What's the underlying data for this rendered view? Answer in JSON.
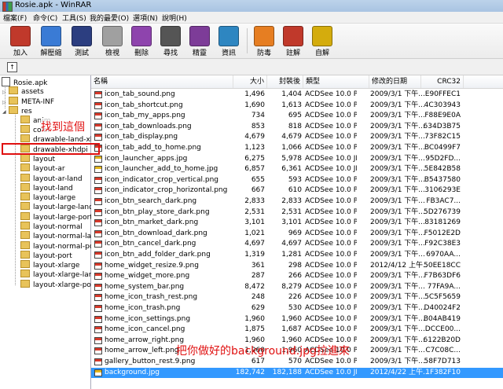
{
  "window": {
    "title": "Rosie.apk - WinRAR"
  },
  "menu": [
    "檔案(F)",
    "命令(C)",
    "工具(S)",
    "我的最愛(O)",
    "選項(N)",
    "說明(H)"
  ],
  "toolbar": [
    "加入",
    "解壓縮到",
    "測試",
    "檢視",
    "刪除",
    "尋找",
    "精靈",
    "資訊",
    "防毒",
    "註解",
    "自解"
  ],
  "toolbar_colors": {
    "add": "#c0392b",
    "extract": "#3a7bd5",
    "test": "#2c3e80",
    "view": "#a0a0a0",
    "delete": "#8e44ad",
    "find": "#555555",
    "wizard": "#7d3c98",
    "info": "#2e86c1",
    "virus": "#e67e22",
    "comment": "#c0392b",
    "sfx": "#d4ac0d"
  },
  "tree": {
    "root": "Rosie.apk",
    "top_items": [
      "assets",
      "META-INF",
      "res"
    ],
    "res_items": [
      "anim",
      "color",
      "drawable-land-xhdpi",
      "drawable-xhdpi",
      "layout",
      "layout-ar",
      "layout-ar-land",
      "layout-land",
      "layout-large",
      "layout-large-land",
      "layout-large-port",
      "layout-normal",
      "layout-normal-land",
      "layout-normal-port",
      "layout-port",
      "layout-xlarge",
      "layout-xlarge-land",
      "layout-xlarge-port"
    ]
  },
  "columns": {
    "name": "名稱",
    "size": "大小",
    "packed": "封裝後",
    "type": "類型",
    "modified": "修改的日期",
    "crc": "CRC32"
  },
  "files": [
    {
      "name": "icon_tab_sound.png",
      "size": "1,496",
      "packed": "1,404",
      "type": "ACDSee 10.0 PN...",
      "modified": "2009/3/1 下午...",
      "crc": "E90FFEC1",
      "kind": "png"
    },
    {
      "name": "icon_tab_shortcut.png",
      "size": "1,690",
      "packed": "1,613",
      "type": "ACDSee 10.0 PN...",
      "modified": "2009/3/1 下午...",
      "crc": "4C303943",
      "kind": "png"
    },
    {
      "name": "icon_tab_my_apps.png",
      "size": "734",
      "packed": "695",
      "type": "ACDSee 10.0 PN...",
      "modified": "2009/3/1 下午...",
      "crc": "F88E9E0A",
      "kind": "png"
    },
    {
      "name": "icon_tab_downloads.png",
      "size": "853",
      "packed": "818",
      "type": "ACDSee 10.0 PN...",
      "modified": "2009/3/1 下午...",
      "crc": "634D3B75",
      "kind": "png"
    },
    {
      "name": "icon_tab_display.png",
      "size": "4,679",
      "packed": "4,679",
      "type": "ACDSee 10.0 PN...",
      "modified": "2009/3/1 下午...",
      "crc": "73F82C15",
      "kind": "png"
    },
    {
      "name": "icon_tab_add_to_home.png",
      "size": "1,123",
      "packed": "1,066",
      "type": "ACDSee 10.0 PN...",
      "modified": "2009/3/1 下午...",
      "crc": "BC0499F7",
      "kind": "png"
    },
    {
      "name": "icon_launcher_apps.jpg",
      "size": "6,275",
      "packed": "5,978",
      "type": "ACDSee 10.0 JPE...",
      "modified": "2009/3/1 下午...",
      "crc": "95D2FD...",
      "kind": "jpg"
    },
    {
      "name": "icon_launcher_add_to_home.jpg",
      "size": "6,857",
      "packed": "6,361",
      "type": "ACDSee 10.0 JPE...",
      "modified": "2009/3/1 下午...",
      "crc": "5E842B58",
      "kind": "jpg"
    },
    {
      "name": "icon_indicator_crop_vertical.png",
      "size": "655",
      "packed": "593",
      "type": "ACDSee 10.0 PN...",
      "modified": "2009/3/1 下午...",
      "crc": "B5437580",
      "kind": "png"
    },
    {
      "name": "icon_indicator_crop_horizontal.png",
      "size": "667",
      "packed": "610",
      "type": "ACDSee 10.0 PN...",
      "modified": "2009/3/1 下午...",
      "crc": "3106293E",
      "kind": "png"
    },
    {
      "name": "icon_btn_search_dark.png",
      "size": "2,833",
      "packed": "2,833",
      "type": "ACDSee 10.0 PN...",
      "modified": "2009/3/1 下午...",
      "crc": "FB3AC7...",
      "kind": "png"
    },
    {
      "name": "icon_btn_play_store_dark.png",
      "size": "2,531",
      "packed": "2,531",
      "type": "ACDSee 10.0 PN...",
      "modified": "2009/3/1 下午...",
      "crc": "5D276739",
      "kind": "png"
    },
    {
      "name": "icon_btn_market_dark.png",
      "size": "3,101",
      "packed": "3,101",
      "type": "ACDSee 10.0 PN...",
      "modified": "2009/3/1 下午...",
      "crc": "83181269",
      "kind": "png"
    },
    {
      "name": "icon_btn_download_dark.png",
      "size": "1,021",
      "packed": "969",
      "type": "ACDSee 10.0 PN...",
      "modified": "2009/3/1 下午...",
      "crc": "F5012E2D",
      "kind": "png"
    },
    {
      "name": "icon_btn_cancel_dark.png",
      "size": "4,697",
      "packed": "4,697",
      "type": "ACDSee 10.0 PN...",
      "modified": "2009/3/1 下午...",
      "crc": "F92C38E3",
      "kind": "png"
    },
    {
      "name": "icon_btn_add_folder_dark.png",
      "size": "1,319",
      "packed": "1,281",
      "type": "ACDSee 10.0 PN...",
      "modified": "2009/3/1 下午...",
      "crc": "6970AA...",
      "kind": "png"
    },
    {
      "name": "home_widget_resize.9.png",
      "size": "361",
      "packed": "298",
      "type": "ACDSee 10.0 PN...",
      "modified": "2012/4/12 上午...",
      "crc": "50EE18CC",
      "kind": "png"
    },
    {
      "name": "home_widget_more.png",
      "size": "287",
      "packed": "266",
      "type": "ACDSee 10.0 PN...",
      "modified": "2009/3/1 下午...",
      "crc": "F7B63DF6",
      "kind": "png"
    },
    {
      "name": "home_system_bar.png",
      "size": "8,472",
      "packed": "8,279",
      "type": "ACDSee 10.0 PN...",
      "modified": "2009/3/1 下午...",
      "crc": "77FA9A...",
      "kind": "png"
    },
    {
      "name": "home_icon_trash_rest.png",
      "size": "248",
      "packed": "226",
      "type": "ACDSee 10.0 PN...",
      "modified": "2009/3/1 下午...",
      "crc": "5C5F5659",
      "kind": "png"
    },
    {
      "name": "home_icon_trash.png",
      "size": "629",
      "packed": "530",
      "type": "ACDSee 10.0 PN...",
      "modified": "2009/3/1 下午...",
      "crc": "D40024F2",
      "kind": "png"
    },
    {
      "name": "home_icon_settings.png",
      "size": "1,960",
      "packed": "1,960",
      "type": "ACDSee 10.0 PN...",
      "modified": "2009/3/1 下午...",
      "crc": "B04AB419",
      "kind": "png"
    },
    {
      "name": "home_icon_cancel.png",
      "size": "1,875",
      "packed": "1,687",
      "type": "ACDSee 10.0 PN...",
      "modified": "2009/3/1 下午...",
      "crc": "DCCE00...",
      "kind": "png"
    },
    {
      "name": "home_arrow_right.png",
      "size": "1,960",
      "packed": "1,960",
      "type": "ACDSee 10.0 PN...",
      "modified": "2009/3/1 下午...",
      "crc": "6122B20D",
      "kind": "png"
    },
    {
      "name": "home_arrow_left.png",
      "size": "1,960",
      "packed": "1,960",
      "type": "ACDSee 10.0 PN...",
      "modified": "2009/3/1 下午...",
      "crc": "C7C08C...",
      "kind": "png"
    },
    {
      "name": "gallery_button_rest.9.png",
      "size": "617",
      "packed": "570",
      "type": "ACDSee 10.0 PN...",
      "modified": "2009/3/1 下午...",
      "crc": "58F7D713",
      "kind": "png"
    },
    {
      "name": "background.jpg",
      "size": "182,742",
      "packed": "182,188",
      "type": "ACDSee 10.0 JPE...",
      "modified": "2012/4/22 上午...",
      "crc": "1F382F10",
      "kind": "jpg",
      "selected": true
    }
  ],
  "annotations": {
    "find_here": "找到這個",
    "drag_in": "把你做好的background.jpg拉進來"
  },
  "colors": {
    "annotation": "#e01010",
    "selection": "#3399ff"
  }
}
